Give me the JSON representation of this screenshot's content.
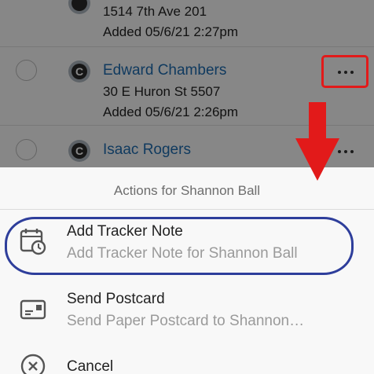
{
  "contacts": [
    {
      "name": "",
      "address": "1514 7th Ave 201",
      "added": "Added 05/6/21 2:27pm"
    },
    {
      "initial": "C",
      "name": "Edward Chambers",
      "address": "30 E Huron St 5507",
      "added": "Added 05/6/21 2:26pm"
    },
    {
      "initial": "C",
      "name": "Isaac Rogers",
      "address": ""
    }
  ],
  "sheet": {
    "title": "Actions for Shannon Ball",
    "actions": [
      {
        "icon": "calendar-clock-icon",
        "title": "Add Tracker Note",
        "subtitle": "Add Tracker Note for Shannon Ball"
      },
      {
        "icon": "postcard-icon",
        "title": "Send Postcard",
        "subtitle": "Send Paper Postcard to Shannon…"
      },
      {
        "icon": "cancel-icon",
        "title": "Cancel",
        "subtitle": ""
      }
    ]
  },
  "colors": {
    "link": "#1f6fb4",
    "annotation_red": "#e21a1a",
    "annotation_blue": "#2e3e9b"
  }
}
